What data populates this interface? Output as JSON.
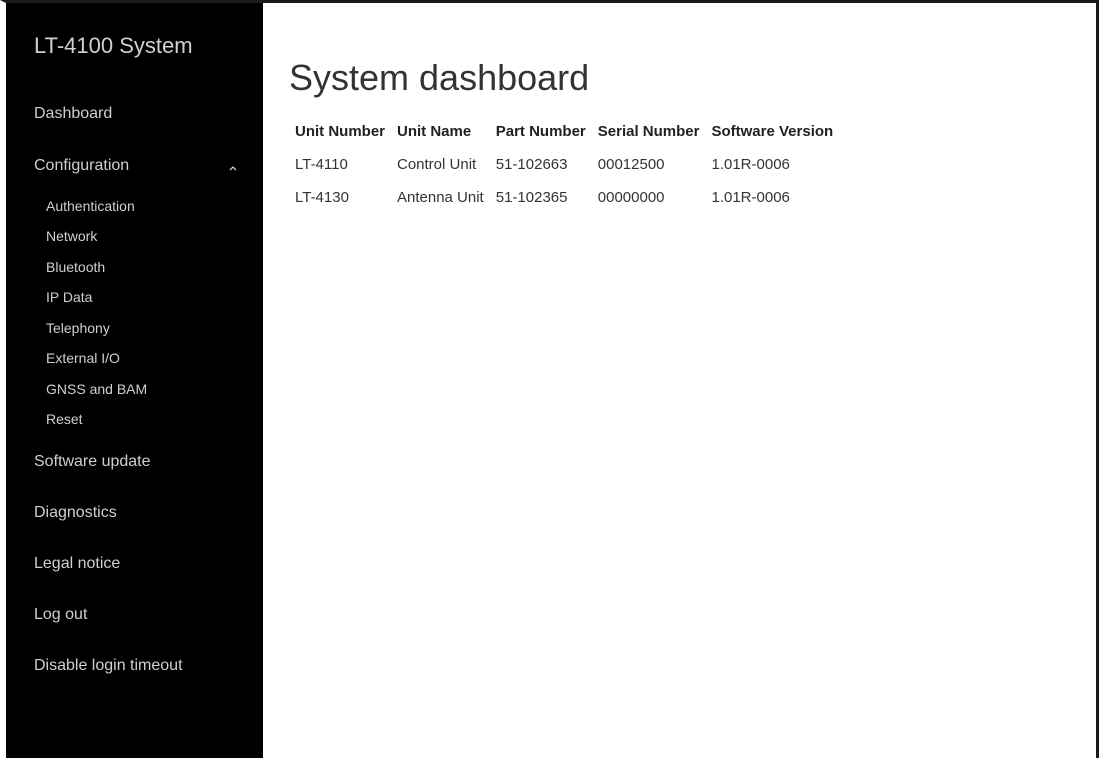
{
  "sidebar": {
    "brand": "LT-4100 System",
    "dashboard": "Dashboard",
    "configuration": "Configuration",
    "config_items": [
      "Authentication",
      "Network",
      "Bluetooth",
      "IP Data",
      "Telephony",
      "External I/O",
      "GNSS and BAM",
      "Reset"
    ],
    "software_update": "Software update",
    "diagnostics": "Diagnostics",
    "legal_notice": "Legal notice",
    "log_out": "Log out",
    "disable_login_timeout": "Disable login timeout",
    "configuration_icon": "chevron-up-icon"
  },
  "main": {
    "title": "System dashboard",
    "table": {
      "headers": [
        "Unit Number",
        "Unit Name",
        "Part Number",
        "Serial Number",
        "Software Version"
      ],
      "rows": [
        [
          "LT-4110",
          "Control Unit",
          "51-102663",
          "00012500",
          "1.01R-0006"
        ],
        [
          "LT-4130",
          "Antenna Unit",
          "51-102365",
          "00000000",
          "1.01R-0006"
        ]
      ]
    }
  },
  "colors": {
    "sidebar_bg": "#000000",
    "sidebar_text": "#cfcfcf",
    "main_bg": "#ffffff",
    "text": "#333333"
  }
}
